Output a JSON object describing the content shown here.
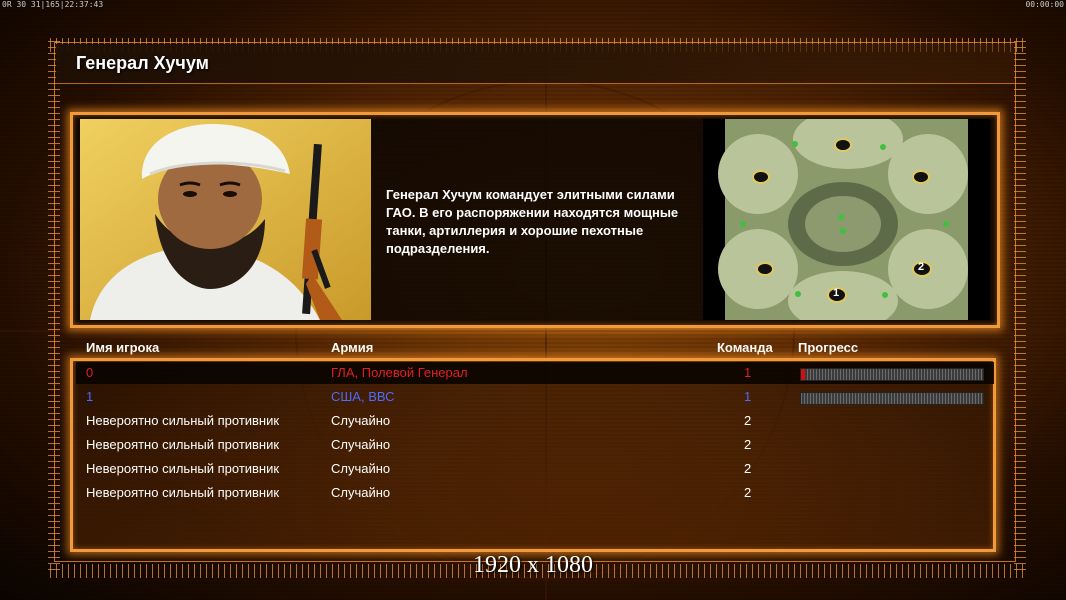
{
  "status": {
    "left": "0R 30 31|165|22:37:43",
    "right": "00:00:00"
  },
  "title": "Генерал Хучум",
  "description": "Генерал Хучум командует элитными силами ГАО. В его распоряжении находятся мощные танки, артиллерия и хорошие пехотные подразделения.",
  "portrait_icon": "general-portrait",
  "minimap": {
    "icon": "map-preview",
    "start_markers": [
      "1",
      "2"
    ]
  },
  "table": {
    "headers": {
      "name": "Имя игрока",
      "army": "Армия",
      "team": "Команда",
      "progress": "Прогресс"
    },
    "rows": [
      {
        "name": "0",
        "army": "ГЛА, Полевой Генерал",
        "team": "1",
        "color": "#e02020",
        "progress": 0.02,
        "selected": true
      },
      {
        "name": "1",
        "army": "США, ВВС",
        "team": "1",
        "color": "#4a6cff",
        "progress": 0.0,
        "selected": false
      },
      {
        "name": "Невероятно сильный противник",
        "army": "Случайно",
        "team": "2",
        "color": "#ffffff"
      },
      {
        "name": "Невероятно сильный противник",
        "army": "Случайно",
        "team": "2",
        "color": "#ffffff"
      },
      {
        "name": "Невероятно сильный противник",
        "army": "Случайно",
        "team": "2",
        "color": "#ffffff"
      },
      {
        "name": "Невероятно сильный противник",
        "army": "Случайно",
        "team": "2",
        "color": "#ffffff"
      }
    ]
  },
  "resolution_label": "1920 x 1080",
  "colors": {
    "accent": "#f29a3a",
    "background": "#6e3205"
  }
}
